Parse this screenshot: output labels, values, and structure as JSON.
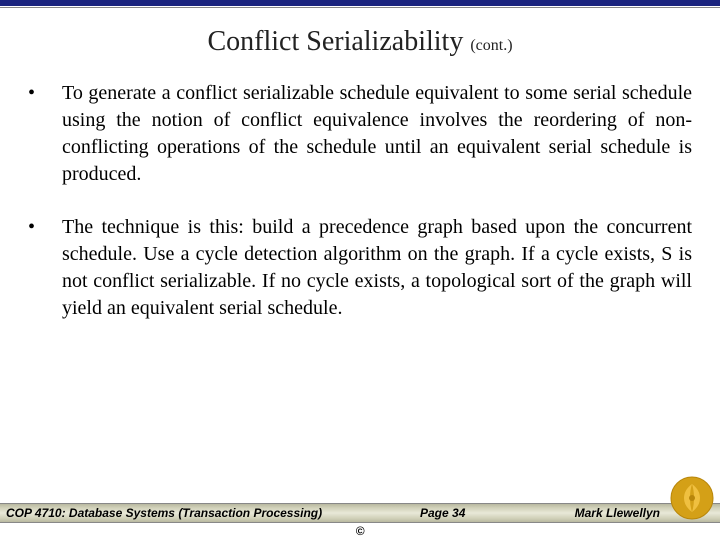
{
  "title": {
    "main": "Conflict Serializability",
    "cont": "(cont.)"
  },
  "bullets": [
    "To generate a conflict serializable schedule equivalent to some serial schedule using the notion of conflict equivalence involves the reordering of non-conflicting operations of the schedule until an equivalent serial schedule is produced.",
    "The technique is this:  build a precedence graph based upon the concurrent schedule.  Use a cycle detection algorithm on the graph.  If a cycle exists, S is not conflict serializable.  If no cycle exists, a topological sort of the graph will yield an equivalent serial schedule."
  ],
  "footer": {
    "course": "COP 4710: Database Systems  (Transaction Processing)",
    "page": "Page 34",
    "author": "Mark Llewellyn",
    "copyright": "©"
  }
}
